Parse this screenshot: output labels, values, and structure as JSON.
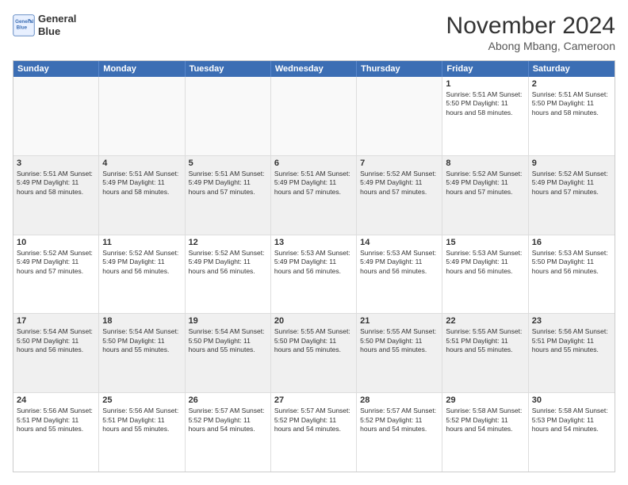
{
  "header": {
    "logo_line1": "General",
    "logo_line2": "Blue",
    "month": "November 2024",
    "location": "Abong Mbang, Cameroon"
  },
  "days_of_week": [
    "Sunday",
    "Monday",
    "Tuesday",
    "Wednesday",
    "Thursday",
    "Friday",
    "Saturday"
  ],
  "weeks": [
    [
      {
        "day": "",
        "info": ""
      },
      {
        "day": "",
        "info": ""
      },
      {
        "day": "",
        "info": ""
      },
      {
        "day": "",
        "info": ""
      },
      {
        "day": "",
        "info": ""
      },
      {
        "day": "1",
        "info": "Sunrise: 5:51 AM\nSunset: 5:50 PM\nDaylight: 11 hours and 58 minutes."
      },
      {
        "day": "2",
        "info": "Sunrise: 5:51 AM\nSunset: 5:50 PM\nDaylight: 11 hours and 58 minutes."
      }
    ],
    [
      {
        "day": "3",
        "info": "Sunrise: 5:51 AM\nSunset: 5:49 PM\nDaylight: 11 hours and 58 minutes."
      },
      {
        "day": "4",
        "info": "Sunrise: 5:51 AM\nSunset: 5:49 PM\nDaylight: 11 hours and 58 minutes."
      },
      {
        "day": "5",
        "info": "Sunrise: 5:51 AM\nSunset: 5:49 PM\nDaylight: 11 hours and 57 minutes."
      },
      {
        "day": "6",
        "info": "Sunrise: 5:51 AM\nSunset: 5:49 PM\nDaylight: 11 hours and 57 minutes."
      },
      {
        "day": "7",
        "info": "Sunrise: 5:52 AM\nSunset: 5:49 PM\nDaylight: 11 hours and 57 minutes."
      },
      {
        "day": "8",
        "info": "Sunrise: 5:52 AM\nSunset: 5:49 PM\nDaylight: 11 hours and 57 minutes."
      },
      {
        "day": "9",
        "info": "Sunrise: 5:52 AM\nSunset: 5:49 PM\nDaylight: 11 hours and 57 minutes."
      }
    ],
    [
      {
        "day": "10",
        "info": "Sunrise: 5:52 AM\nSunset: 5:49 PM\nDaylight: 11 hours and 57 minutes."
      },
      {
        "day": "11",
        "info": "Sunrise: 5:52 AM\nSunset: 5:49 PM\nDaylight: 11 hours and 56 minutes."
      },
      {
        "day": "12",
        "info": "Sunrise: 5:52 AM\nSunset: 5:49 PM\nDaylight: 11 hours and 56 minutes."
      },
      {
        "day": "13",
        "info": "Sunrise: 5:53 AM\nSunset: 5:49 PM\nDaylight: 11 hours and 56 minutes."
      },
      {
        "day": "14",
        "info": "Sunrise: 5:53 AM\nSunset: 5:49 PM\nDaylight: 11 hours and 56 minutes."
      },
      {
        "day": "15",
        "info": "Sunrise: 5:53 AM\nSunset: 5:49 PM\nDaylight: 11 hours and 56 minutes."
      },
      {
        "day": "16",
        "info": "Sunrise: 5:53 AM\nSunset: 5:50 PM\nDaylight: 11 hours and 56 minutes."
      }
    ],
    [
      {
        "day": "17",
        "info": "Sunrise: 5:54 AM\nSunset: 5:50 PM\nDaylight: 11 hours and 56 minutes."
      },
      {
        "day": "18",
        "info": "Sunrise: 5:54 AM\nSunset: 5:50 PM\nDaylight: 11 hours and 55 minutes."
      },
      {
        "day": "19",
        "info": "Sunrise: 5:54 AM\nSunset: 5:50 PM\nDaylight: 11 hours and 55 minutes."
      },
      {
        "day": "20",
        "info": "Sunrise: 5:55 AM\nSunset: 5:50 PM\nDaylight: 11 hours and 55 minutes."
      },
      {
        "day": "21",
        "info": "Sunrise: 5:55 AM\nSunset: 5:50 PM\nDaylight: 11 hours and 55 minutes."
      },
      {
        "day": "22",
        "info": "Sunrise: 5:55 AM\nSunset: 5:51 PM\nDaylight: 11 hours and 55 minutes."
      },
      {
        "day": "23",
        "info": "Sunrise: 5:56 AM\nSunset: 5:51 PM\nDaylight: 11 hours and 55 minutes."
      }
    ],
    [
      {
        "day": "24",
        "info": "Sunrise: 5:56 AM\nSunset: 5:51 PM\nDaylight: 11 hours and 55 minutes."
      },
      {
        "day": "25",
        "info": "Sunrise: 5:56 AM\nSunset: 5:51 PM\nDaylight: 11 hours and 55 minutes."
      },
      {
        "day": "26",
        "info": "Sunrise: 5:57 AM\nSunset: 5:52 PM\nDaylight: 11 hours and 54 minutes."
      },
      {
        "day": "27",
        "info": "Sunrise: 5:57 AM\nSunset: 5:52 PM\nDaylight: 11 hours and 54 minutes."
      },
      {
        "day": "28",
        "info": "Sunrise: 5:57 AM\nSunset: 5:52 PM\nDaylight: 11 hours and 54 minutes."
      },
      {
        "day": "29",
        "info": "Sunrise: 5:58 AM\nSunset: 5:52 PM\nDaylight: 11 hours and 54 minutes."
      },
      {
        "day": "30",
        "info": "Sunrise: 5:58 AM\nSunset: 5:53 PM\nDaylight: 11 hours and 54 minutes."
      }
    ]
  ]
}
